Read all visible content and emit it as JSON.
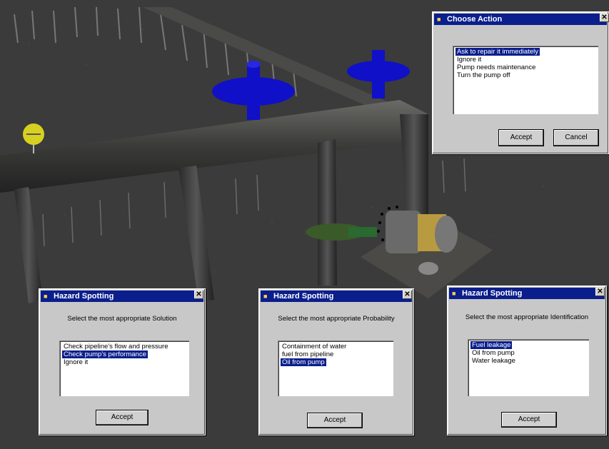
{
  "choose_action": {
    "title": "Choose Action",
    "options": [
      "Ask to repair it immediately",
      "Ignore it",
      "Pump needs maintenance",
      "Turn the pump off"
    ],
    "selected_index": 0,
    "accept_label": "Accept",
    "cancel_label": "Cancel"
  },
  "hazard_solution": {
    "title": "Hazard Spotting",
    "prompt": "Select the most appropriate Solution",
    "options": [
      "Check pipeline's flow and pressure",
      "Check pump's performance",
      "Ignore it"
    ],
    "selected_index": 1,
    "accept_label": "Accept"
  },
  "hazard_probability": {
    "title": "Hazard Spotting",
    "prompt": "Select the most appropriate Probability",
    "options": [
      "Containment of water",
      "fuel from pipeline",
      "Oil from pump"
    ],
    "selected_index": 2,
    "accept_label": "Accept"
  },
  "hazard_identification": {
    "title": "Hazard Spotting",
    "prompt": "Select the most appropriate Identification",
    "options": [
      "Fuel leakage",
      "Oil from pump",
      "Water leakage"
    ],
    "selected_index": 0,
    "accept_label": "Accept"
  },
  "colors": {
    "titlebar": "#0a1e8c",
    "dialog_bg": "#c8c8c8",
    "valve_blue": "#1010c8",
    "marker_yellow": "#d8d020"
  },
  "icons": {
    "app": "app-icon",
    "close": "close-icon"
  }
}
